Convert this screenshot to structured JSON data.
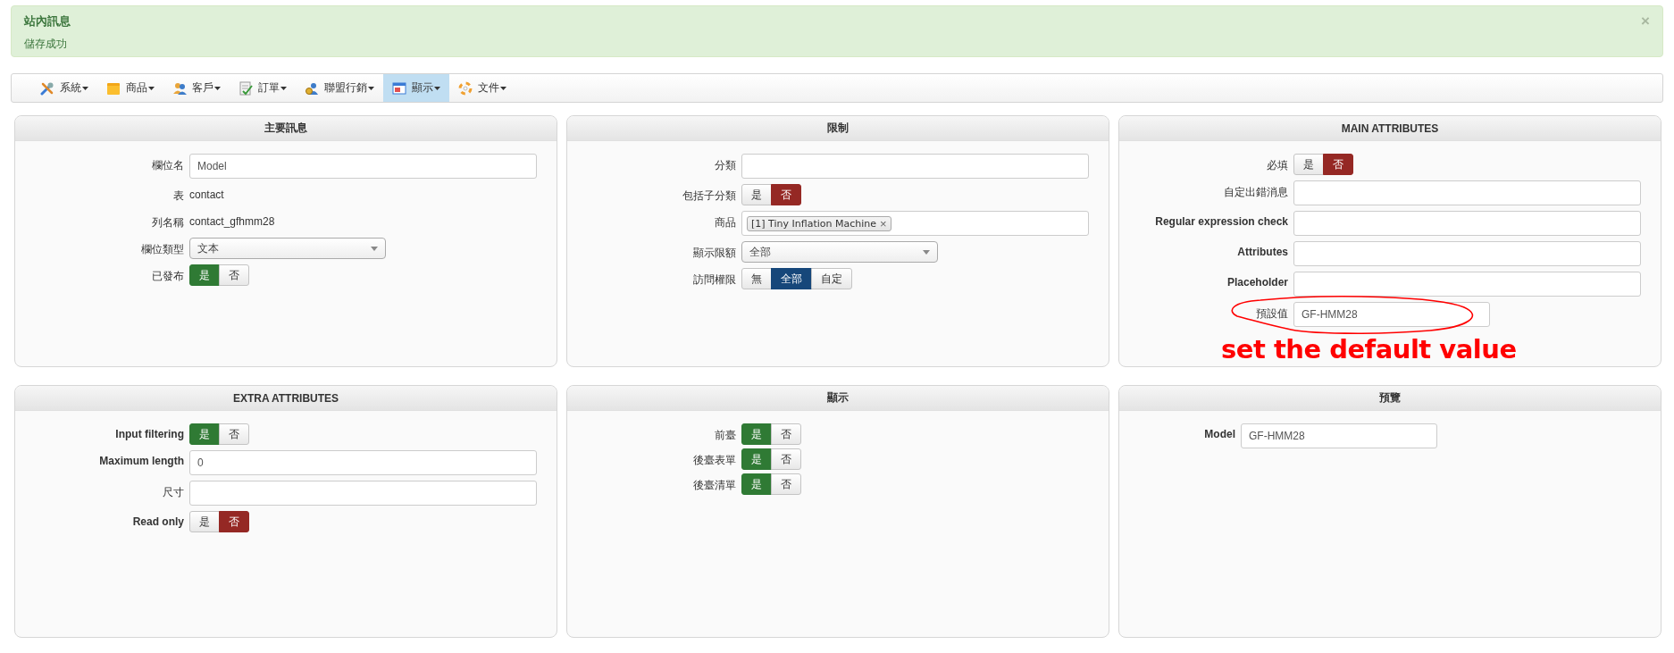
{
  "alert": {
    "title": "站內訊息",
    "message": "儲存成功",
    "close": "×"
  },
  "menu": [
    {
      "label": "系統",
      "selected": false
    },
    {
      "label": "商品",
      "selected": false
    },
    {
      "label": "客戶",
      "selected": false
    },
    {
      "label": "訂單",
      "selected": false
    },
    {
      "label": "聯盟行銷",
      "selected": false
    },
    {
      "label": "顯示",
      "selected": true
    },
    {
      "label": "文件",
      "selected": false
    }
  ],
  "panels": [
    {
      "title": "主要訊息",
      "kind": "form",
      "rows": [
        {
          "label": "欄位名",
          "bold": false,
          "kind": "text",
          "value": "Model"
        },
        {
          "label": "表",
          "bold": false,
          "kind": "static",
          "value": "contact"
        },
        {
          "label": "列名稱",
          "bold": false,
          "kind": "static",
          "value": "contact_gfhmm28"
        },
        {
          "label": "欄位類型",
          "bold": false,
          "kind": "select",
          "value": "文本"
        },
        {
          "label": "已發布",
          "bold": false,
          "kind": "toggle",
          "options": [
            {
              "label": "是",
              "selected": true,
              "color": "#2f7a34"
            },
            {
              "label": "否",
              "selected": false
            }
          ]
        }
      ]
    },
    {
      "title": "限制",
      "kind": "form",
      "rows": [
        {
          "label": "分類",
          "bold": false,
          "kind": "text"
        },
        {
          "label": "包括子分類",
          "bold": false,
          "kind": "toggle",
          "options": [
            {
              "label": "是",
              "selected": false
            },
            {
              "label": "否",
              "selected": true,
              "color": "#952824"
            }
          ]
        },
        {
          "label": "商品",
          "bold": false,
          "kind": "tags",
          "tags": [
            {
              "label": "[1] Tiny Inflation Machine",
              "remove": "×"
            }
          ]
        },
        {
          "label": "顯示限額",
          "bold": false,
          "kind": "select",
          "value": "全部"
        },
        {
          "label": "訪問權限",
          "bold": false,
          "kind": "toggle",
          "options": [
            {
              "label": "無",
              "selected": false
            },
            {
              "label": "全部",
              "selected": true,
              "color": "#16477a"
            },
            {
              "label": "自定",
              "selected": false
            }
          ]
        }
      ]
    },
    {
      "title": "MAIN ATTRIBUTES",
      "kind": "form",
      "rows": [
        {
          "label": "必填",
          "bold": false,
          "kind": "toggle",
          "options": [
            {
              "label": "是",
              "selected": false
            },
            {
              "label": "否",
              "selected": true,
              "color": "#952824"
            }
          ]
        },
        {
          "label": "自定出錯消息",
          "bold": false,
          "kind": "text"
        },
        {
          "label": "Regular expression check",
          "bold": true,
          "kind": "text"
        },
        {
          "label": "Attributes",
          "bold": true,
          "kind": "text"
        },
        {
          "label": "Placeholder",
          "bold": true,
          "kind": "text"
        },
        {
          "label": "預設值",
          "bold": false,
          "kind": "text-short",
          "value": "GF-HMM28",
          "annotation": "set the default value"
        }
      ]
    },
    {
      "title": "EXTRA ATTRIBUTES",
      "kind": "form",
      "rows": [
        {
          "label": "Input filtering",
          "bold": true,
          "kind": "toggle",
          "options": [
            {
              "label": "是",
              "selected": true,
              "color": "#2f7a34"
            },
            {
              "label": "否",
              "selected": false
            }
          ]
        },
        {
          "label": "Maximum length",
          "bold": true,
          "kind": "text",
          "value": "0"
        },
        {
          "label": "尺寸",
          "bold": false,
          "kind": "text"
        },
        {
          "label": "Read only",
          "bold": true,
          "kind": "toggle",
          "options": [
            {
              "label": "是",
              "selected": false
            },
            {
              "label": "否",
              "selected": true,
              "color": "#952824"
            }
          ]
        }
      ]
    },
    {
      "title": "顯示",
      "kind": "form",
      "rows": [
        {
          "label": "前臺",
          "bold": false,
          "kind": "toggle",
          "options": [
            {
              "label": "是",
              "selected": true,
              "color": "#2f7a34"
            },
            {
              "label": "否",
              "selected": false
            }
          ]
        },
        {
          "label": "後臺表單",
          "bold": false,
          "kind": "toggle",
          "options": [
            {
              "label": "是",
              "selected": true,
              "color": "#2f7a34"
            },
            {
              "label": "否",
              "selected": false
            }
          ]
        },
        {
          "label": "後臺清單",
          "bold": false,
          "kind": "toggle",
          "options": [
            {
              "label": "是",
              "selected": true,
              "color": "#2f7a34"
            },
            {
              "label": "否",
              "selected": false
            }
          ]
        }
      ]
    },
    {
      "title": "預覽",
      "kind": "preview",
      "rows": [
        {
          "label": "Model",
          "bold": true,
          "kind": "text-short",
          "value": "GF-HMM28"
        }
      ]
    }
  ]
}
